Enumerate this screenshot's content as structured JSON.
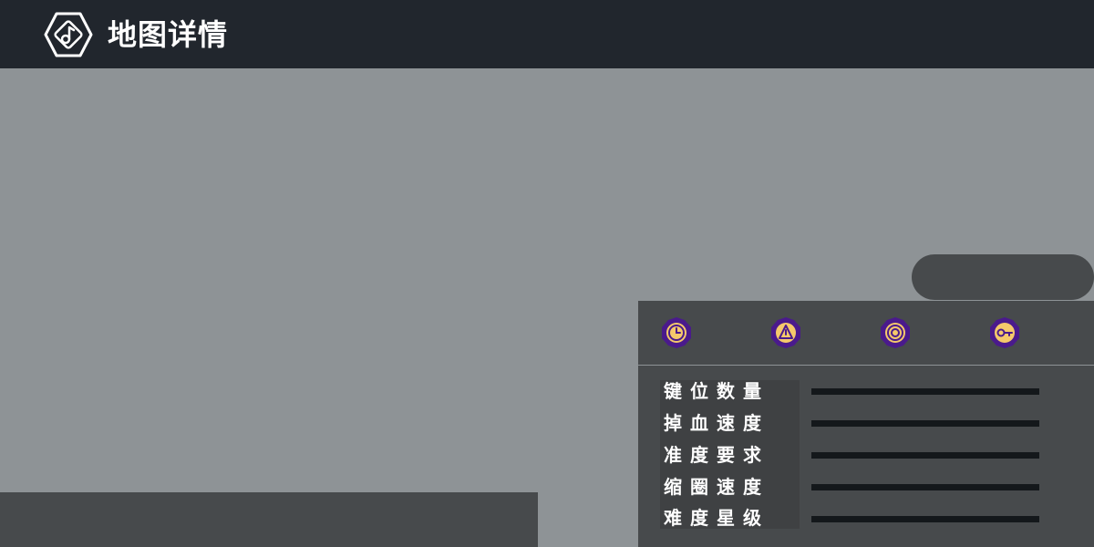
{
  "header": {
    "title": "地图详情",
    "logo_icon": "music-note-hexagon-icon"
  },
  "mods": [
    {
      "icon": "clock-icon",
      "name": "mod-clock"
    },
    {
      "icon": "warning-triangle-icon",
      "name": "mod-triangle"
    },
    {
      "icon": "target-circle-icon",
      "name": "mod-target"
    },
    {
      "icon": "key-icon",
      "name": "mod-key"
    }
  ],
  "stats": [
    {
      "label": "键位数量",
      "value": 0
    },
    {
      "label": "掉血速度",
      "value": 0
    },
    {
      "label": "准度要求",
      "value": 0
    },
    {
      "label": "缩圈速度",
      "value": 0
    },
    {
      "label": "难度星级",
      "value": 0
    }
  ],
  "colors": {
    "header_bg": "#21262d",
    "page_bg": "#8e9396",
    "panel_bg": "#474a4c",
    "mod_icon_ring": "#4a1a8c",
    "mod_icon_fill": "#f5c96b",
    "stat_bar_bg": "#14181b"
  }
}
